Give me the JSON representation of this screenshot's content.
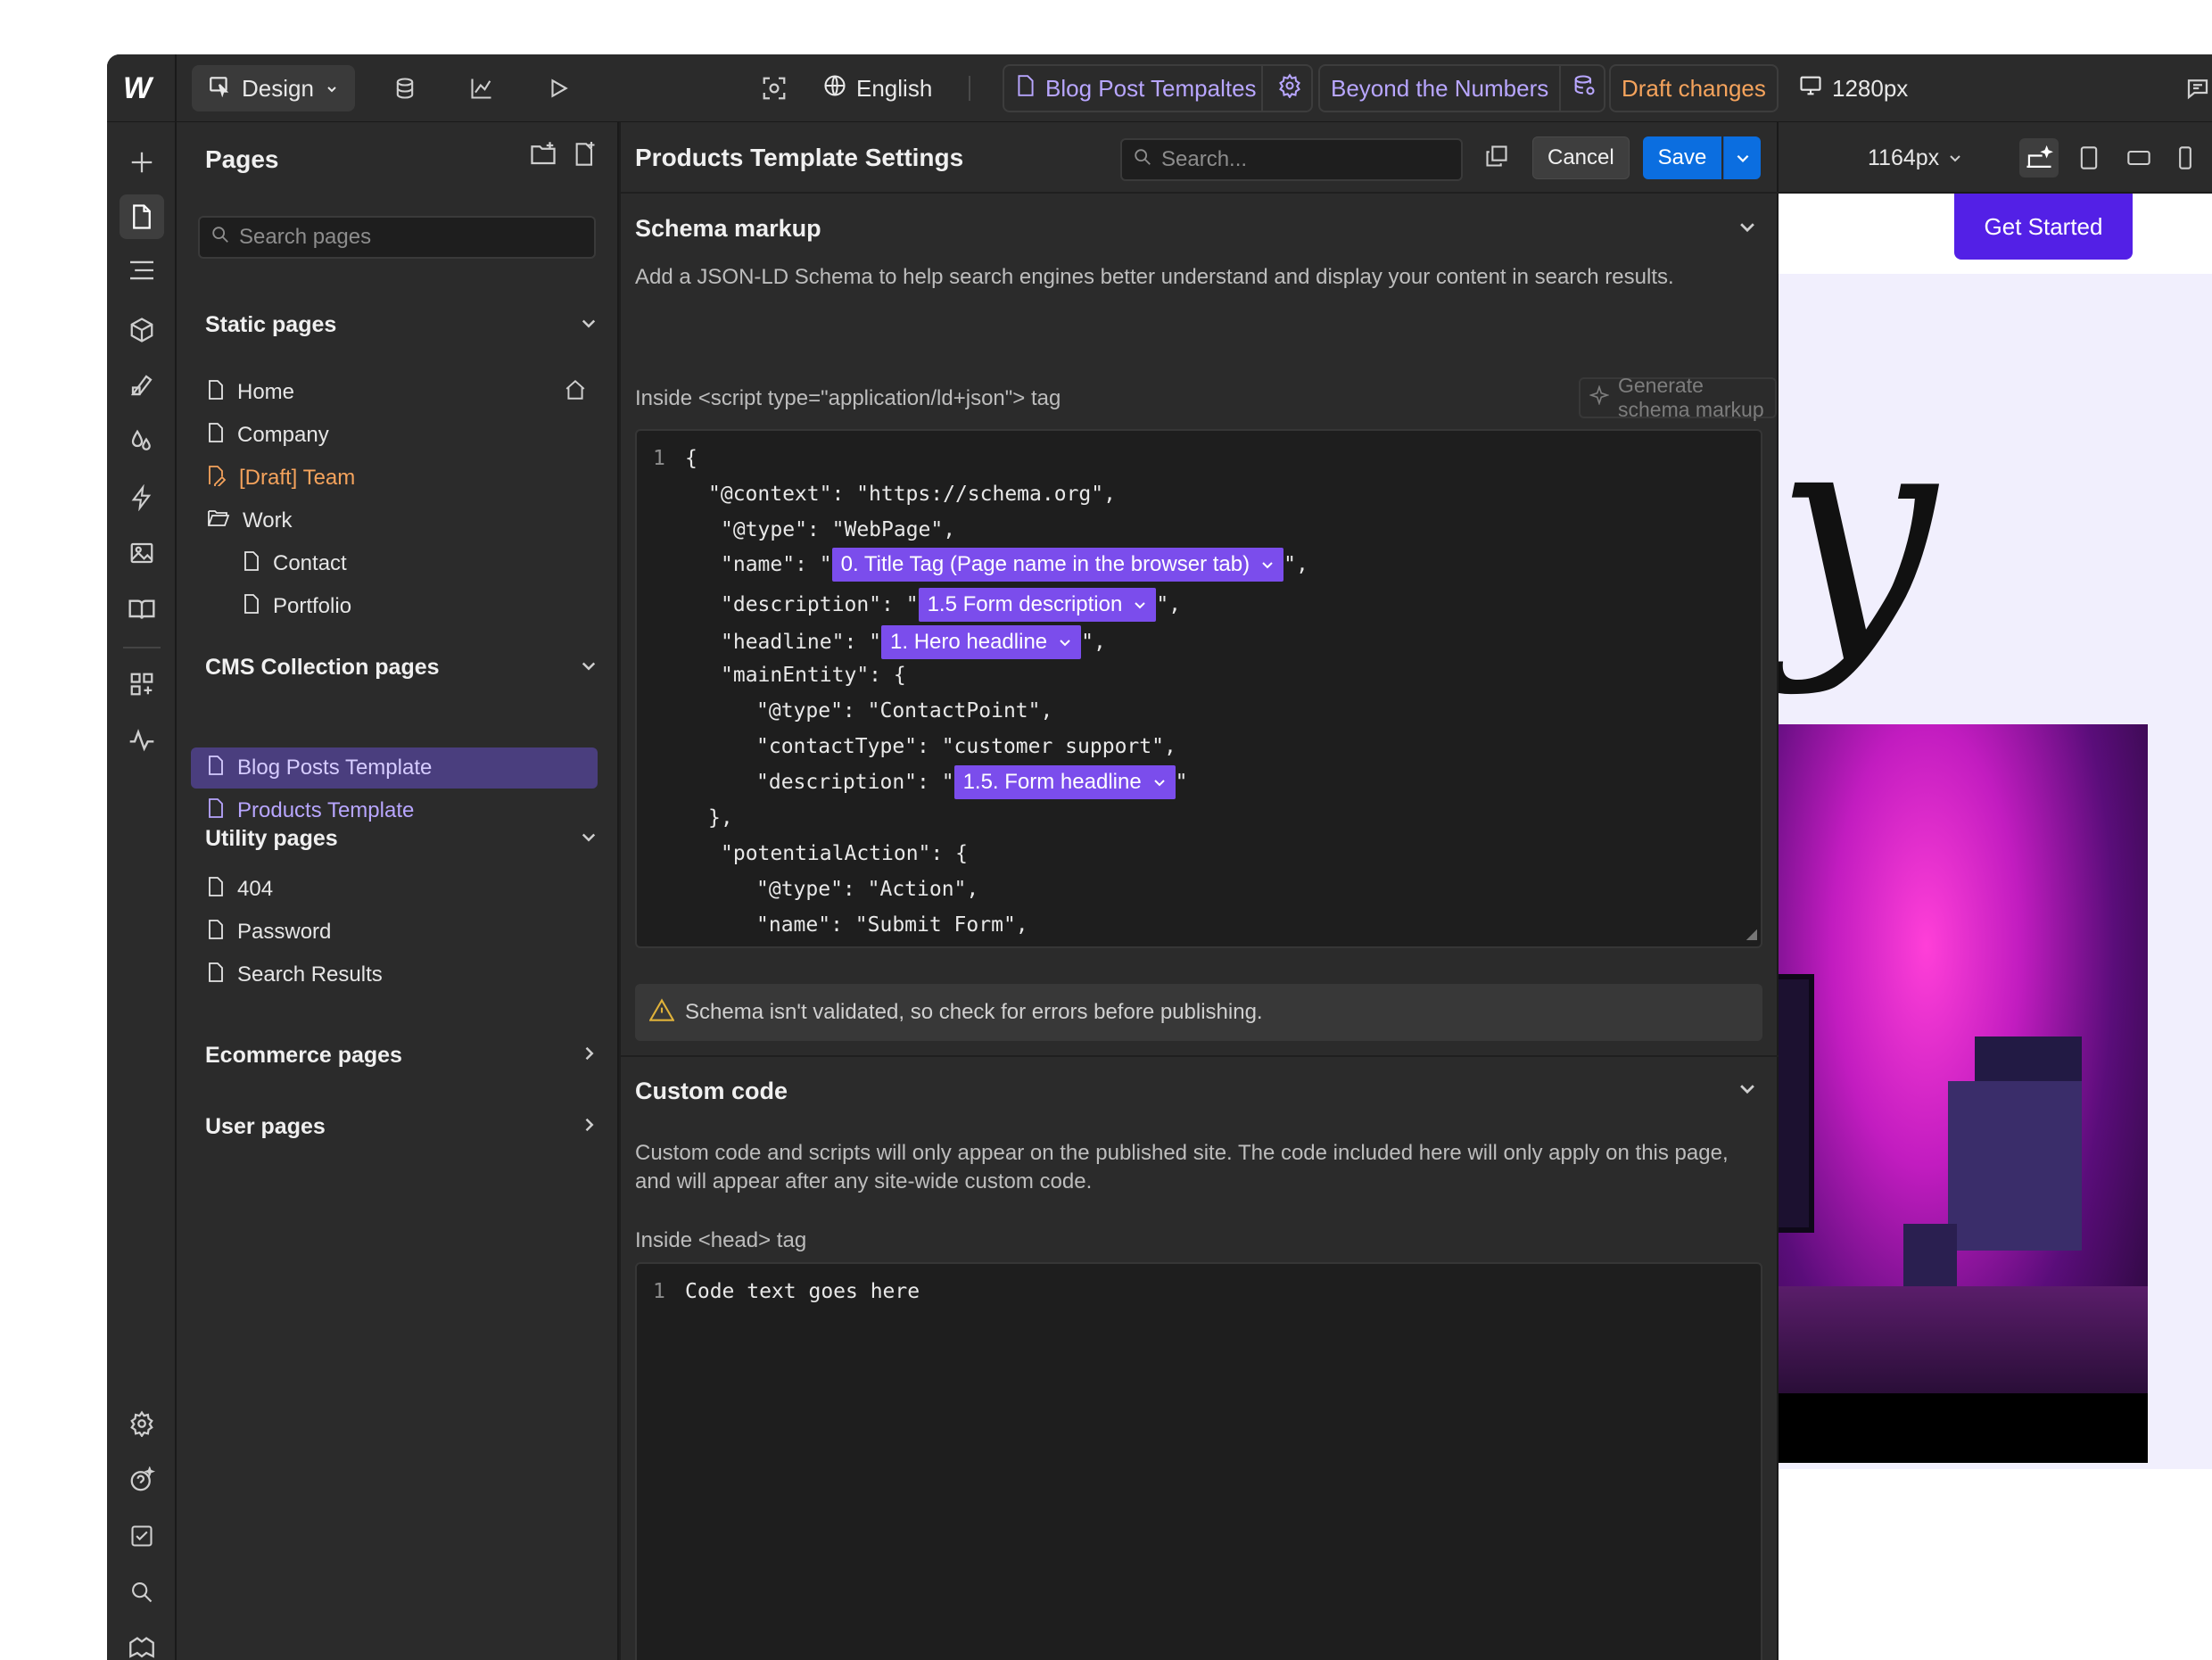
{
  "topbar": {
    "logo": "W",
    "mode_label": "Design",
    "language": "English",
    "page_template": "Blog Post Tempaltes",
    "collection_item": "Beyond the Numbers",
    "draft_status": "Draft changes",
    "viewport": "1280px"
  },
  "pages_panel": {
    "title": "Pages",
    "search_placeholder": "Search pages",
    "static": {
      "heading": "Static pages",
      "items": [
        "Home",
        "Company",
        "[Draft] Team",
        "Work",
        "Contact",
        "Portfolio"
      ]
    },
    "cms": {
      "heading": "CMS Collection pages",
      "items": [
        "Blog Posts Template",
        "Products Template"
      ]
    },
    "utility": {
      "heading": "Utility pages",
      "items": [
        "404",
        "Password",
        "Search Results"
      ]
    },
    "ecommerce": {
      "heading": "Ecommerce pages"
    },
    "user": {
      "heading": "User pages"
    }
  },
  "settings": {
    "title": "Products Template Settings",
    "search_placeholder": "Search...",
    "cancel": "Cancel",
    "save": "Save",
    "schema": {
      "title": "Schema markup",
      "description": "Add a JSON-LD Schema to help search engines better understand and display your content in search results.",
      "field_label": "Inside <script type=\"application/ld+json\"> tag",
      "generate_label": "Generate schema markup",
      "code": {
        "line_number": "1",
        "l1": "{",
        "l2": "\"@context\": \"https://schema.org\",",
        "l3": "\"@type\": \"WebPage\",",
        "l4_pre": "\"name\": \"",
        "l4_tag": "0. Title Tag (Page name in the browser tab)",
        "l4_post": "\",",
        "l5_pre": "\"description\": \"",
        "l5_tag": "1.5 Form description",
        "l5_post": "\",",
        "l6_pre": "\"headline\": \"",
        "l6_tag": "1. Hero headline",
        "l6_post": "\",",
        "l7": "\"mainEntity\": {",
        "l8": "\"@type\": \"ContactPoint\",",
        "l9": "\"contactType\": \"customer support\",",
        "l10_pre": "\"description\": \"",
        "l10_tag": "1.5. Form headline",
        "l10_post": "\"",
        "l11": "},",
        "l12": "\"potentialAction\": {",
        "l13": "\"@type\": \"Action\",",
        "l14": "\"name\": \"Submit Form\","
      },
      "warning": "Schema isn't validated, so check for errors before publishing."
    },
    "custom_code": {
      "title": "Custom code",
      "description": "Custom code and scripts will only appear on the published site. The code included here will only apply on this page, and will appear after any site-wide custom code.",
      "field_label": "Inside <head> tag",
      "line_number": "1",
      "placeholder": "Code text goes here"
    }
  },
  "canvas": {
    "width_label": "1164px",
    "cta": "Get Started",
    "hero_letter": "y"
  },
  "colors": {
    "accent_purple": "#7b4dec",
    "save_blue": "#0b6ee0",
    "draft_orange": "#f5a35c",
    "cta_purple": "#5320e6"
  }
}
